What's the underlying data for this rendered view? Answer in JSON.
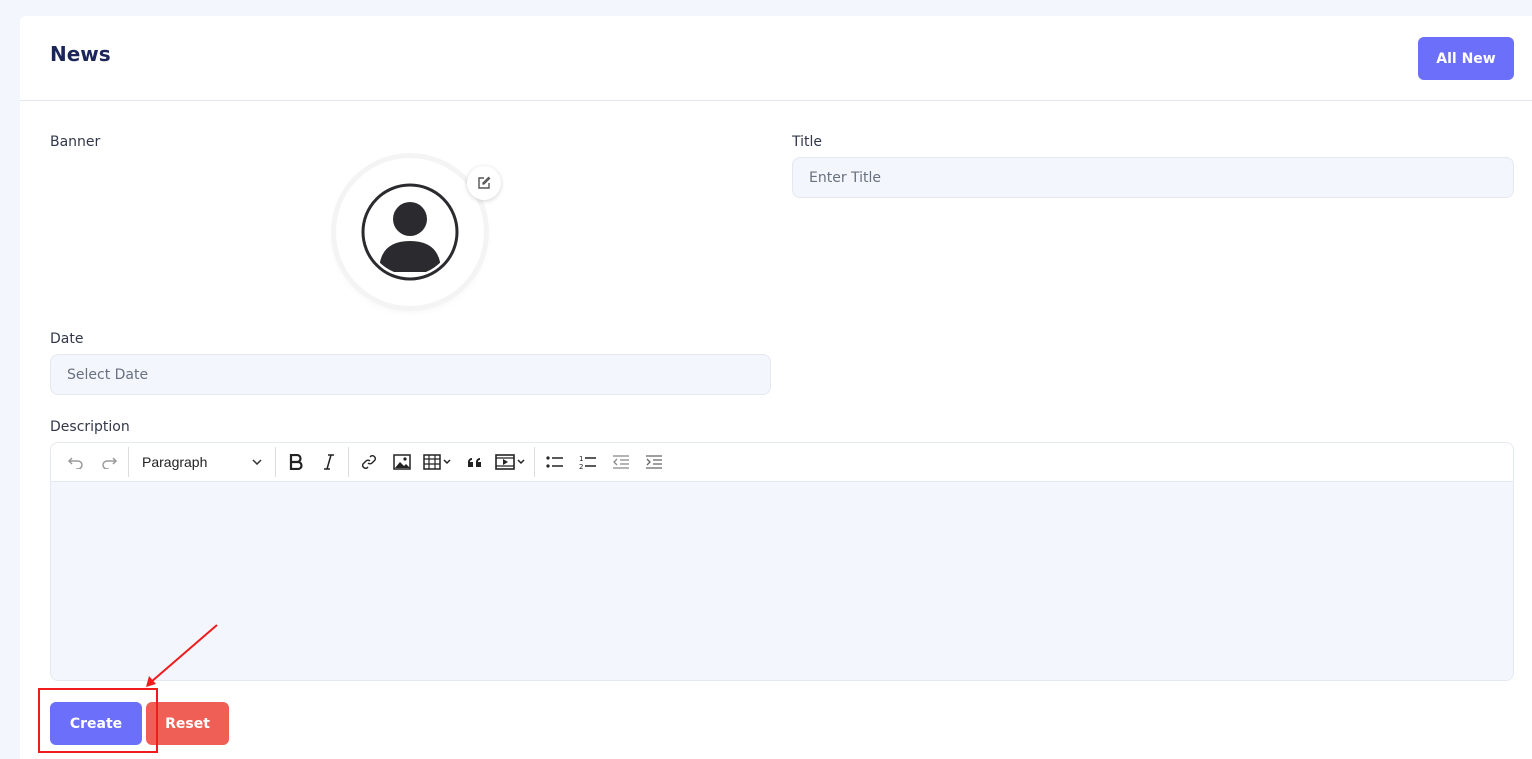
{
  "header": {
    "title": "News",
    "all_new_label": "All New"
  },
  "form": {
    "banner_label": "Banner",
    "title_label": "Title",
    "title_placeholder": "Enter Title",
    "date_label": "Date",
    "date_placeholder": "Select Date",
    "description_label": "Description"
  },
  "editor": {
    "block_format": "Paragraph",
    "toolbar_icons": [
      "undo-icon",
      "redo-icon",
      "bold-icon",
      "italic-icon",
      "link-icon",
      "image-icon",
      "table-icon",
      "quote-icon",
      "media-icon",
      "bulleted-list-icon",
      "numbered-list-icon",
      "outdent-icon",
      "indent-icon"
    ]
  },
  "actions": {
    "create_label": "Create",
    "reset_label": "Reset"
  },
  "colors": {
    "primary": "#6c6ffa",
    "danger": "#ef5f56",
    "annotation": "#ee1c1c",
    "title": "#1b2559"
  }
}
